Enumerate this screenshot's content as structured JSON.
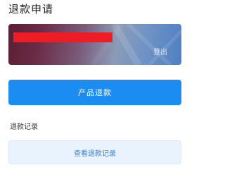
{
  "header": {
    "title": "退款申请"
  },
  "account_card": {
    "logout_label": "登出"
  },
  "actions": {
    "product_refund_label": "产品退款"
  },
  "records": {
    "section_label": "退款记录",
    "view_button_label": "查看退款记录"
  },
  "colors": {
    "primary": "#1a8cf2",
    "secondary_bg": "#e9f3fd",
    "secondary_text": "#3c7fcf",
    "redaction": "#ee1c24"
  }
}
